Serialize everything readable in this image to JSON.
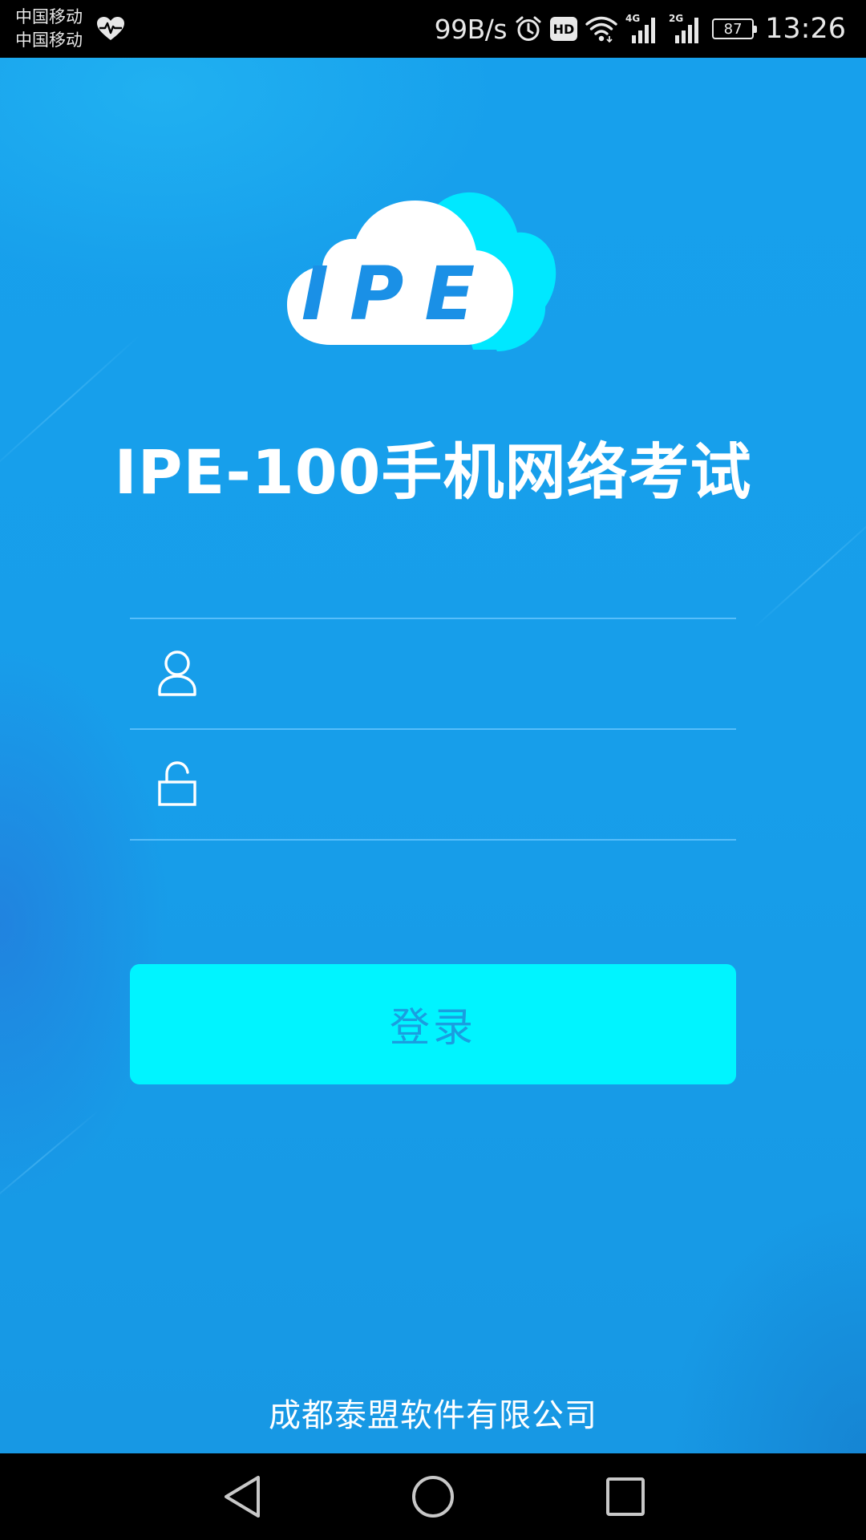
{
  "status_bar": {
    "carrier_1": "中国移动",
    "carrier_2": "中国移动",
    "net_speed": "99B/s",
    "hd_label": "HD",
    "signal_1_label": "4G",
    "signal_2_label": "2G",
    "battery_level": "87",
    "time": "13:26",
    "icons": [
      "heart-rate-icon",
      "alarm-icon",
      "hd-icon",
      "wifi-icon",
      "signal-4g-icon",
      "signal-2g-icon",
      "battery-icon"
    ]
  },
  "logo": {
    "text": "IPE",
    "colors": {
      "cloud_front": "#ffffff",
      "cloud_back": "#00e8ff",
      "text": "#1a90e6"
    }
  },
  "app": {
    "title": "IPE-100手机网络考试",
    "username_field": {
      "icon": "user-icon",
      "placeholder": "",
      "value": ""
    },
    "password_field": {
      "icon": "lock-icon",
      "placeholder": "",
      "value": ""
    },
    "login_label": "登录",
    "company": "成都泰盟软件有限公司"
  },
  "nav_bar": {
    "icons": [
      "back-triangle-icon",
      "home-circle-icon",
      "recents-square-icon"
    ]
  },
  "colors": {
    "background": "#179eea",
    "button": "#00f4ff",
    "button_text": "#1a9ee0",
    "divider": "#6ec8ff"
  }
}
